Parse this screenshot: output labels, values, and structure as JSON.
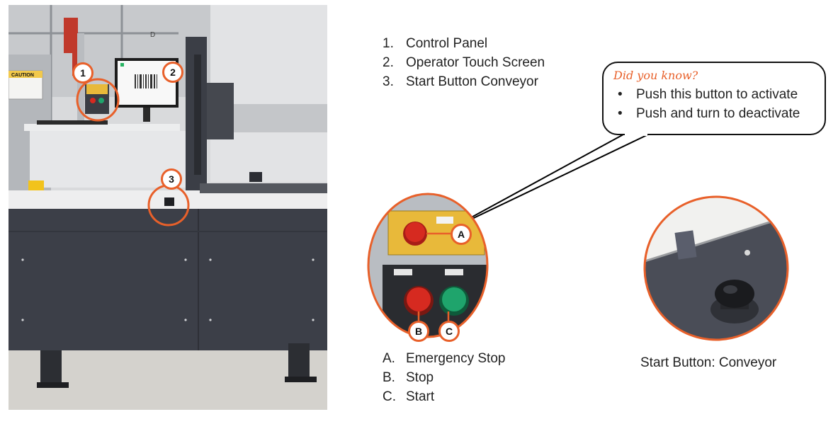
{
  "legend_numbers": {
    "items": [
      {
        "marker": "1.",
        "label": "Control Panel"
      },
      {
        "marker": "2.",
        "label": "Operator Touch Screen"
      },
      {
        "marker": "3.",
        "label": "Start Button Conveyor"
      }
    ]
  },
  "callout": {
    "title": "Did you know?",
    "bullets": [
      "Push this button to activate",
      "Push and turn to deactivate"
    ]
  },
  "legend_letters": {
    "items": [
      {
        "marker": "A.",
        "label": "Emergency Stop"
      },
      {
        "marker": "B.",
        "label": "Stop"
      },
      {
        "marker": "C.",
        "label": "Start"
      }
    ]
  },
  "conveyor_caption": "Start Button: Conveyor",
  "photo_badges": [
    "1",
    "2",
    "3"
  ],
  "panel_badges": [
    "A",
    "B",
    "C"
  ],
  "photo_text": {
    "caution_sign": "CAUTION",
    "machine_letter": "D"
  },
  "colors": {
    "accent_orange": "#e8602a",
    "machine_dark": "#3c3f48",
    "estop_red": "#d62a20",
    "start_green": "#1fa46c",
    "box_yellow": "#e8b93a"
  }
}
